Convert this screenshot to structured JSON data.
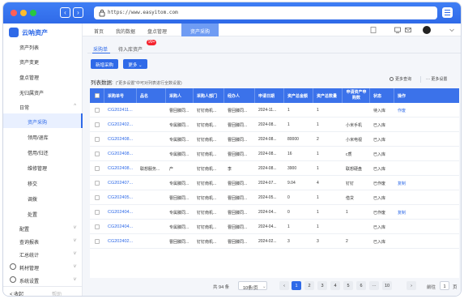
{
  "browser": {
    "url": "https://www.easyitom.com",
    "colors": {
      "close": "#ff5f57",
      "minimize": "#febc2e",
      "maximize": "#28c840",
      "accent": "#2f6ae8"
    }
  },
  "sidebar": {
    "app_name": "云呐资产",
    "items": [
      {
        "label": "资产列表"
      },
      {
        "label": "资产变更"
      },
      {
        "label": "盘点管理"
      },
      {
        "label": "无归属资产"
      },
      {
        "label": "日常",
        "chevron": "^"
      },
      {
        "label": "资产采购"
      },
      {
        "label": "领用/退库"
      },
      {
        "label": "借用/归还"
      },
      {
        "label": "维修管理"
      },
      {
        "label": "移交"
      },
      {
        "label": "调拨"
      },
      {
        "label": "处置"
      },
      {
        "label": "配置",
        "chevron": "v"
      },
      {
        "label": "查询报表",
        "chevron": "v"
      },
      {
        "label": "汇总统计",
        "chevron": "v"
      },
      {
        "label": "耗材管理",
        "chevron": "v"
      },
      {
        "label": "系统设置",
        "chevron": "v"
      }
    ],
    "footer": {
      "collapse": "< 收起",
      "help": "帮助"
    }
  },
  "header": {
    "tabs": [
      "首页",
      "我的数据",
      "盘点管理",
      "资产采购"
    ],
    "active_tab": "资产采购"
  },
  "page": {
    "subtabs": [
      {
        "label": "采购单"
      },
      {
        "label": "待入库资产",
        "badge": "99+"
      }
    ],
    "buttons": {
      "new": "新增采购",
      "more": "更多 ⌄"
    },
    "list_title": "列表数据:",
    "list_hint": "(\"更多设置\"中可对列表进行全数设置)",
    "tools": {
      "search": "更多查询",
      "settings": "··· 更多设置"
    },
    "table": {
      "columns": [
        "采购单号",
        "品名",
        "采购人",
        "采购人部门",
        "经办人",
        "申请日期",
        "资产总金额",
        "资产总数量",
        "申请资产申购数",
        "状态",
        "操作"
      ],
      "rows": [
        [
          "CG202411...",
          "",
          "曹回滕同...",
          "钉钉南机...",
          "曹回滕同...",
          "2024-11...",
          "1",
          "1",
          "",
          "待入库",
          "作废"
        ],
        [
          "CG202402...",
          "",
          "专属滕同...",
          "钉钉南机...",
          "曹回滕同...",
          "2024-08...",
          "1",
          "1",
          "小米手机",
          "已入库",
          ""
        ],
        [
          "CG202408...",
          "",
          "专属滕同...",
          "钉钉南机...",
          "曹回滕同...",
          "2024-08...",
          "80000",
          "2",
          "小米电视",
          "已入库",
          ""
        ],
        [
          "CG202408...",
          "",
          "专属滕同...",
          "钉钉南机...",
          "曹回滕同...",
          "2024-08...",
          "16",
          "1",
          "c质",
          "已入库",
          ""
        ],
        [
          "CG202408...",
          "联想服务...",
          "产",
          "钉钉南机...",
          "李",
          "2024-08...",
          "3900",
          "1",
          "联想硬盘",
          "已入库",
          ""
        ],
        [
          "CG202407...",
          "",
          "专属滕同...",
          "钉钉南机...",
          "曹回滕同...",
          "2024-07...",
          "9.04",
          "4",
          "钉钉",
          "已作废",
          "复制"
        ],
        [
          "CG202405...",
          "",
          "曹回滕同...",
          "钉钉南机...",
          "曹回滕同...",
          "2024-05...",
          "0",
          "1",
          "借贷",
          "已入库",
          ""
        ],
        [
          "CG202404...",
          "",
          "专属滕同...",
          "钉钉南机...",
          "曹回滕同...",
          "2024-04...",
          "0",
          "1",
          "1",
          "已作废",
          "复制"
        ],
        [
          "CG202404...",
          "",
          "专属滕同...",
          "钉钉南机...",
          "曹回滕同...",
          "2024-04...",
          "1",
          "1",
          "",
          "已入库",
          ""
        ],
        [
          "CG202402...",
          "",
          "曹回滕同...",
          "钉钉南机...",
          "曹回滕同...",
          "2024-02...",
          "3",
          "3",
          "2",
          "已入库",
          ""
        ]
      ]
    },
    "pagination": {
      "total": "共 94 条",
      "page_size": "10条/页",
      "pages": [
        "1",
        "2",
        "3",
        "4",
        "5",
        "6",
        "···",
        "10"
      ],
      "current": "1",
      "goto_label": "前往",
      "goto_value": "1",
      "page_unit": "页"
    }
  }
}
